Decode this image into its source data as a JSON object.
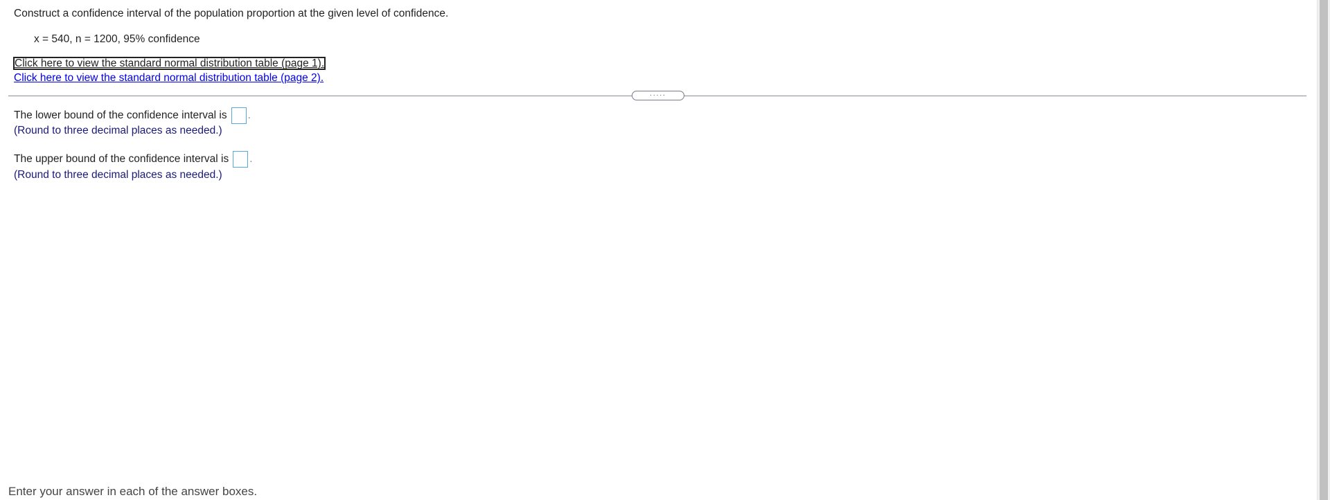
{
  "question": {
    "instruction": "Construct a confidence interval of the population proportion at the given level of confidence.",
    "given": "x = 540, n = 1200, 95% confidence"
  },
  "links": {
    "table_page1": "Click here to view the standard normal distribution table (page 1).",
    "table_page2": "Click here to view the standard normal distribution table (page 2)."
  },
  "divider": {
    "handle_label": "....."
  },
  "answers": [
    {
      "label": "The lower bound of the confidence interval is",
      "value": "",
      "hint": "(Round to three decimal places as needed.)"
    },
    {
      "label": "The upper bound of the confidence interval is",
      "value": "",
      "hint": "(Round to three decimal places as needed.)"
    }
  ],
  "footer": {
    "text": "Enter your answer in each of the answer boxes."
  },
  "colors": {
    "link": "#0000ee",
    "hint": "#1a1a7a",
    "answer_box_border": "#5aa8d8"
  }
}
